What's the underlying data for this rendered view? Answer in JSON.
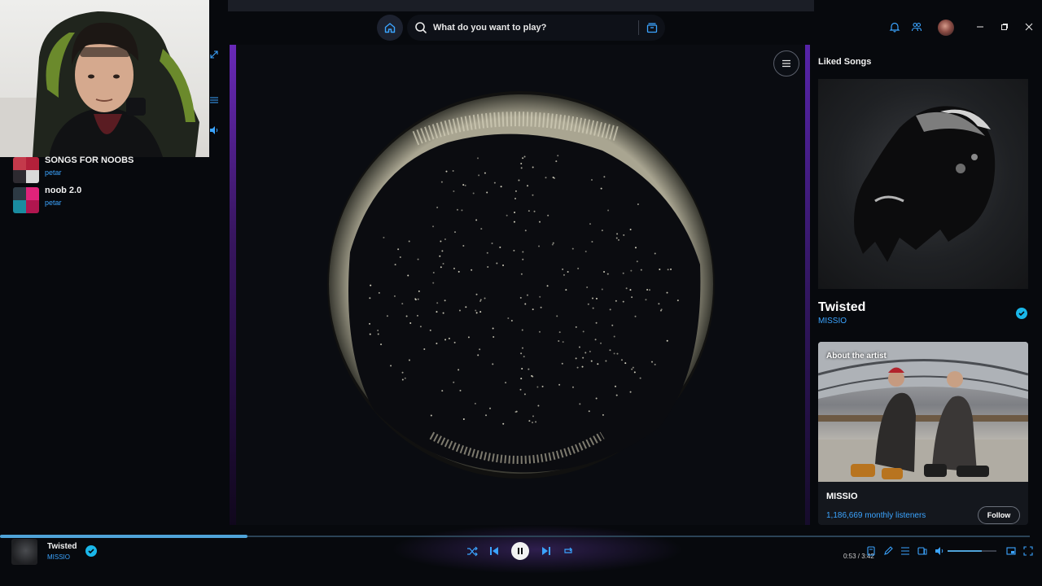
{
  "search": {
    "placeholder": "What do you want to play?"
  },
  "sidebar": {
    "playlists": [
      {
        "name": "SONGS FOR NOOBS",
        "owner": "petar"
      },
      {
        "name": "noob 2.0",
        "owner": "petar"
      }
    ]
  },
  "right_panel": {
    "title": "Liked Songs",
    "song_title": "Twisted",
    "song_artist": "MISSIO",
    "about_label": "About the artist",
    "artist_name": "MISSIO",
    "listeners": "1,186,669 monthly listeners",
    "follow_label": "Follow"
  },
  "player": {
    "track_title": "Twisted",
    "track_artist": "MISSIO",
    "time": "0:53",
    "duration": "3:42",
    "progress_fraction": 0.24,
    "volume_fraction": 0.7
  },
  "icons": {
    "home": "home-icon",
    "search": "search-icon",
    "browse": "browse-icon",
    "bell": "bell-icon",
    "friends": "friends-icon",
    "menu": "menu-icon",
    "shuffle": "shuffle-icon",
    "prev": "previous-icon",
    "pause": "pause-icon",
    "next": "next-icon",
    "repeat": "repeat-icon"
  },
  "colors": {
    "accent": "#3ba4ff",
    "check": "#1ab7e9",
    "purple": "#7a2fd6"
  }
}
